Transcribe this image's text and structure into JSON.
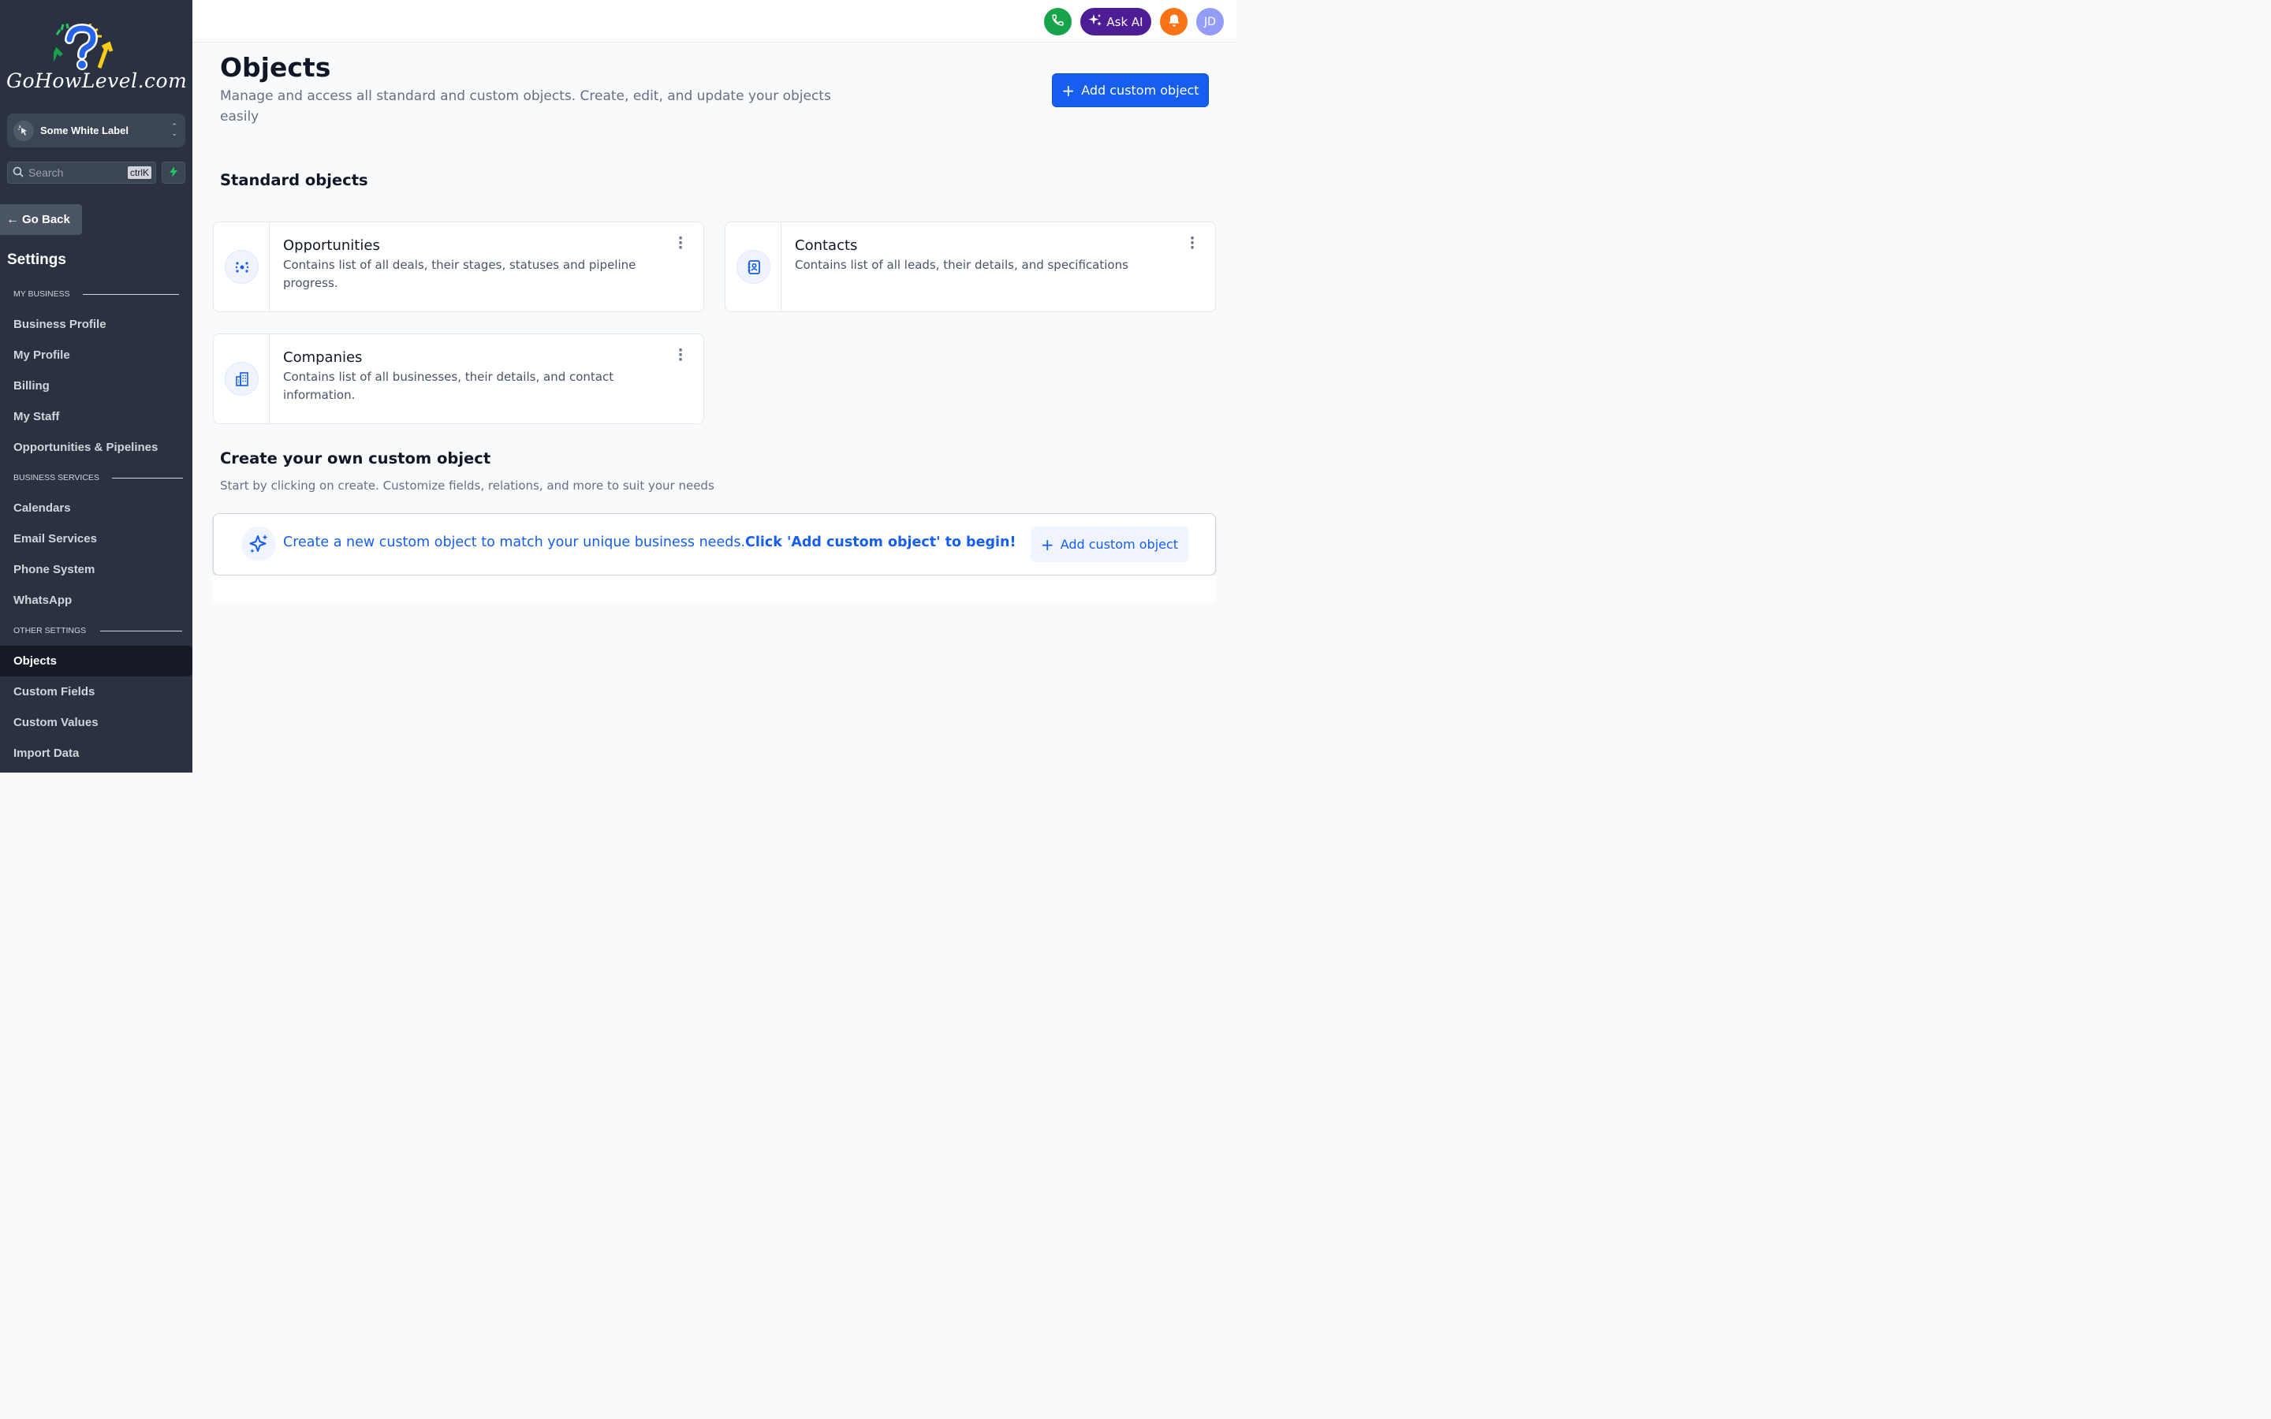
{
  "sidebar": {
    "logo_text": "GoHowLevel.com",
    "location_name": "Some White Label",
    "search_placeholder": "Search",
    "search_shortcut": "ctrlK",
    "go_back": "Go Back",
    "settings_title": "Settings",
    "sections": {
      "my_business": "MY BUSINESS",
      "business_services": "BUSINESS SERVICES",
      "other_settings": "OTHER SETTINGS"
    },
    "items": {
      "business_profile": "Business Profile",
      "my_profile": "My Profile",
      "billing": "Billing",
      "my_staff": "My Staff",
      "opportunities_pipelines": "Opportunities & Pipelines",
      "calendars": "Calendars",
      "email_services": "Email Services",
      "phone_system": "Phone System",
      "whatsapp": "WhatsApp",
      "objects": "Objects",
      "custom_fields": "Custom Fields",
      "custom_values": "Custom Values",
      "import_data": "Import Data"
    },
    "active_item": "Objects"
  },
  "header": {
    "ask_ai": "Ask AI",
    "avatar_initials": "JD",
    "colors": {
      "phone": "#16a34a",
      "ask_ai": "#4c1d95",
      "bell": "#f97316",
      "avatar": "#818cf8"
    }
  },
  "main": {
    "title": "Objects",
    "subtitle": "Manage and access all standard and custom objects. Create, edit, and update your objects easily",
    "add_button": "Add custom object",
    "standard_heading": "Standard objects",
    "cards": {
      "opportunities": {
        "title": "Opportunities",
        "desc": "Contains list of all deals, their stages, statuses and pipeline progress.",
        "icon": "target-icon"
      },
      "contacts": {
        "title": "Contacts",
        "desc": "Contains list of all leads, their details, and specifications",
        "icon": "contact-book-icon"
      },
      "companies": {
        "title": "Companies",
        "desc": "Contains list of all businesses, their details, and contact information.",
        "icon": "building-icon"
      }
    },
    "custom_heading": "Create your own custom object",
    "custom_sub": "Start by clicking on create. Customize fields, relations, and more to suit your needs",
    "banner": {
      "text": "Create a new custom object to match your unique business needs.",
      "bold": "Click 'Add custom object' to begin!",
      "button": "Add custom object"
    },
    "accent_color": "#155eef"
  }
}
